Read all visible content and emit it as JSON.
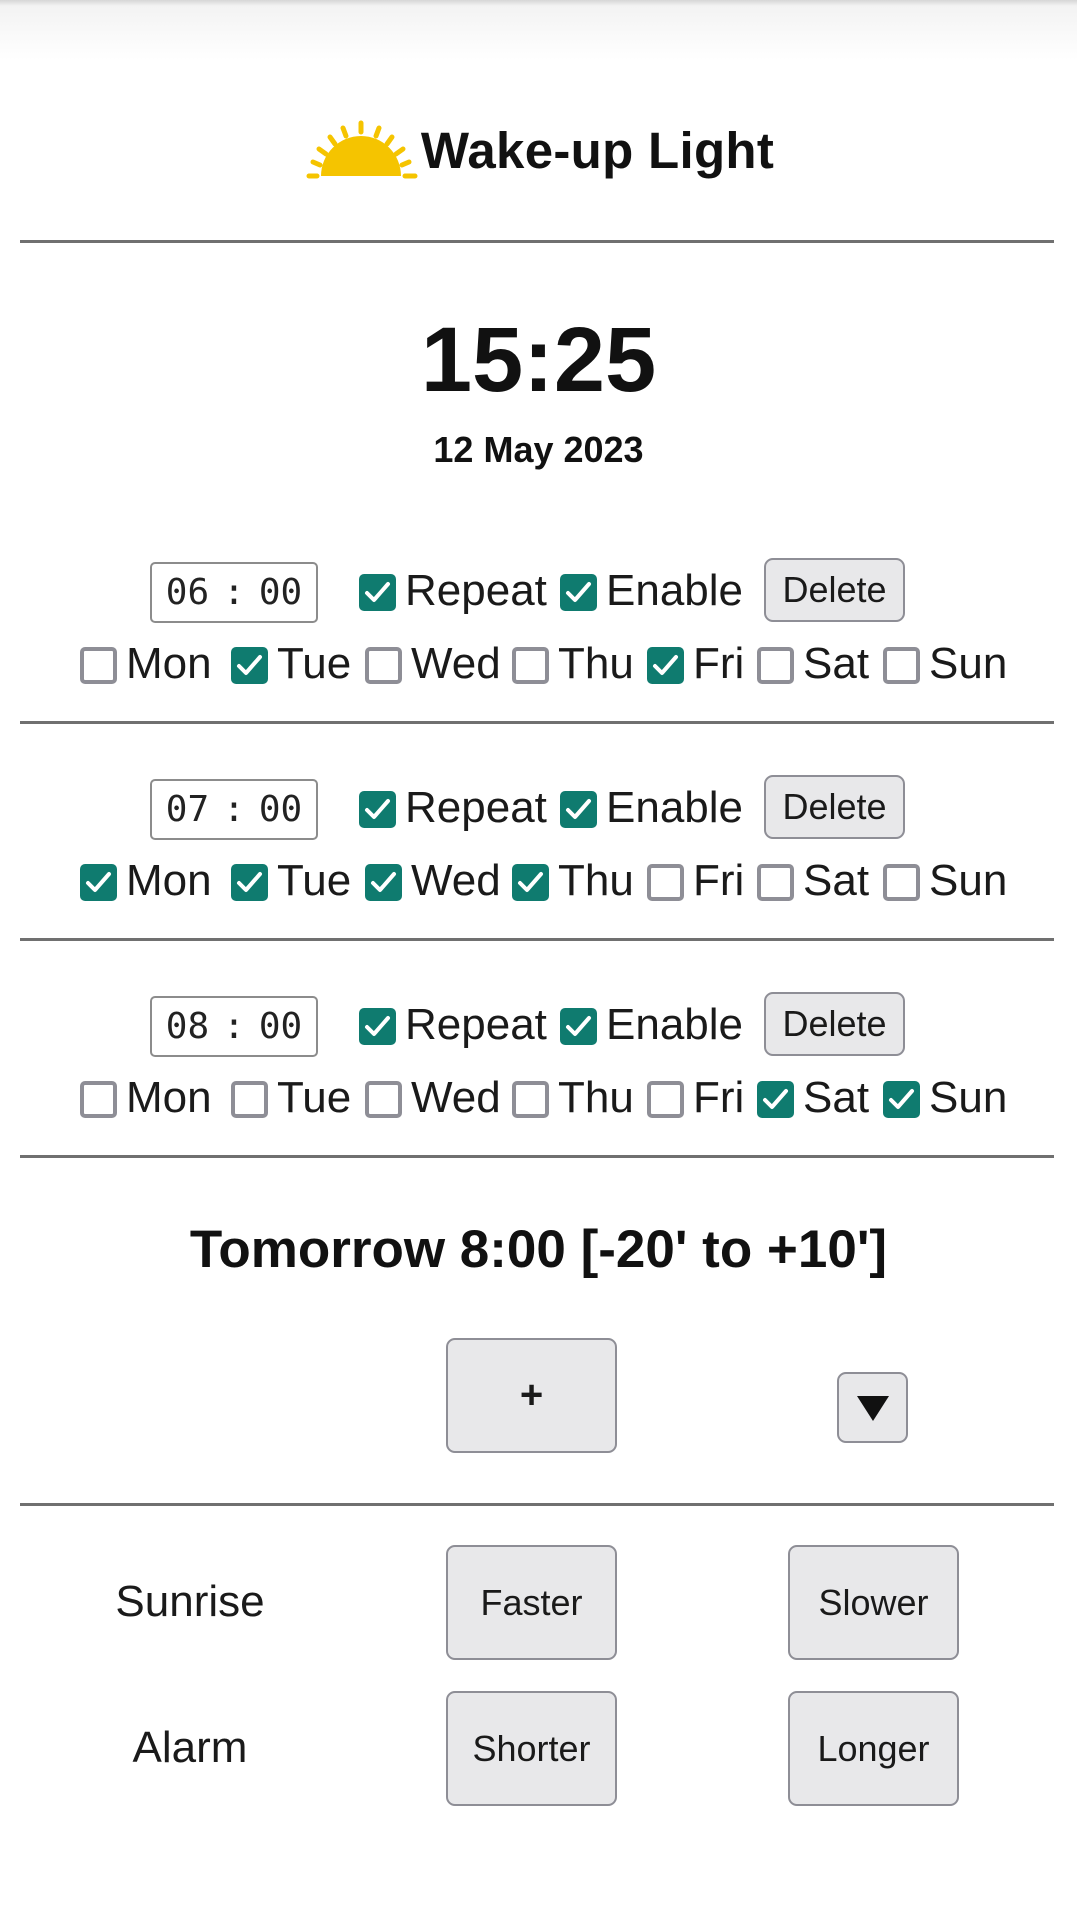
{
  "header": {
    "title": "Wake-up Light",
    "logo_icon": "sun-icon",
    "logo_color": "#f5c400"
  },
  "clock": {
    "time": "15:25",
    "date": "12 May 2023"
  },
  "accent_color": "#0f7b6f",
  "alarms": [
    {
      "hour": "06",
      "minute": "00",
      "repeat_label": "Repeat",
      "repeat": true,
      "enable_label": "Enable",
      "enable": true,
      "delete_label": "Delete",
      "days": [
        {
          "label": "Mon",
          "checked": false
        },
        {
          "label": "Tue",
          "checked": true
        },
        {
          "label": "Wed",
          "checked": false
        },
        {
          "label": "Thu",
          "checked": false
        },
        {
          "label": "Fri",
          "checked": true
        },
        {
          "label": "Sat",
          "checked": false
        },
        {
          "label": "Sun",
          "checked": false
        }
      ]
    },
    {
      "hour": "07",
      "minute": "00",
      "repeat_label": "Repeat",
      "repeat": true,
      "enable_label": "Enable",
      "enable": true,
      "delete_label": "Delete",
      "days": [
        {
          "label": "Mon",
          "checked": true
        },
        {
          "label": "Tue",
          "checked": true
        },
        {
          "label": "Wed",
          "checked": true
        },
        {
          "label": "Thu",
          "checked": true
        },
        {
          "label": "Fri",
          "checked": false
        },
        {
          "label": "Sat",
          "checked": false
        },
        {
          "label": "Sun",
          "checked": false
        }
      ]
    },
    {
      "hour": "08",
      "minute": "00",
      "repeat_label": "Repeat",
      "repeat": true,
      "enable_label": "Enable",
      "enable": true,
      "delete_label": "Delete",
      "days": [
        {
          "label": "Mon",
          "checked": false
        },
        {
          "label": "Tue",
          "checked": false
        },
        {
          "label": "Wed",
          "checked": false
        },
        {
          "label": "Thu",
          "checked": false
        },
        {
          "label": "Fri",
          "checked": false
        },
        {
          "label": "Sat",
          "checked": true
        },
        {
          "label": "Sun",
          "checked": true
        }
      ]
    }
  ],
  "next_alarm": "Tomorrow 8:00 [-20' to +10']",
  "controls": {
    "add_label": "+",
    "expand_icon": "triangle-down-icon",
    "expand_glyph": "▼"
  },
  "adjust": {
    "sunrise": {
      "label": "Sunrise",
      "faster": "Faster",
      "slower": "Slower"
    },
    "alarm": {
      "label": "Alarm",
      "shorter": "Shorter",
      "longer": "Longer"
    }
  }
}
